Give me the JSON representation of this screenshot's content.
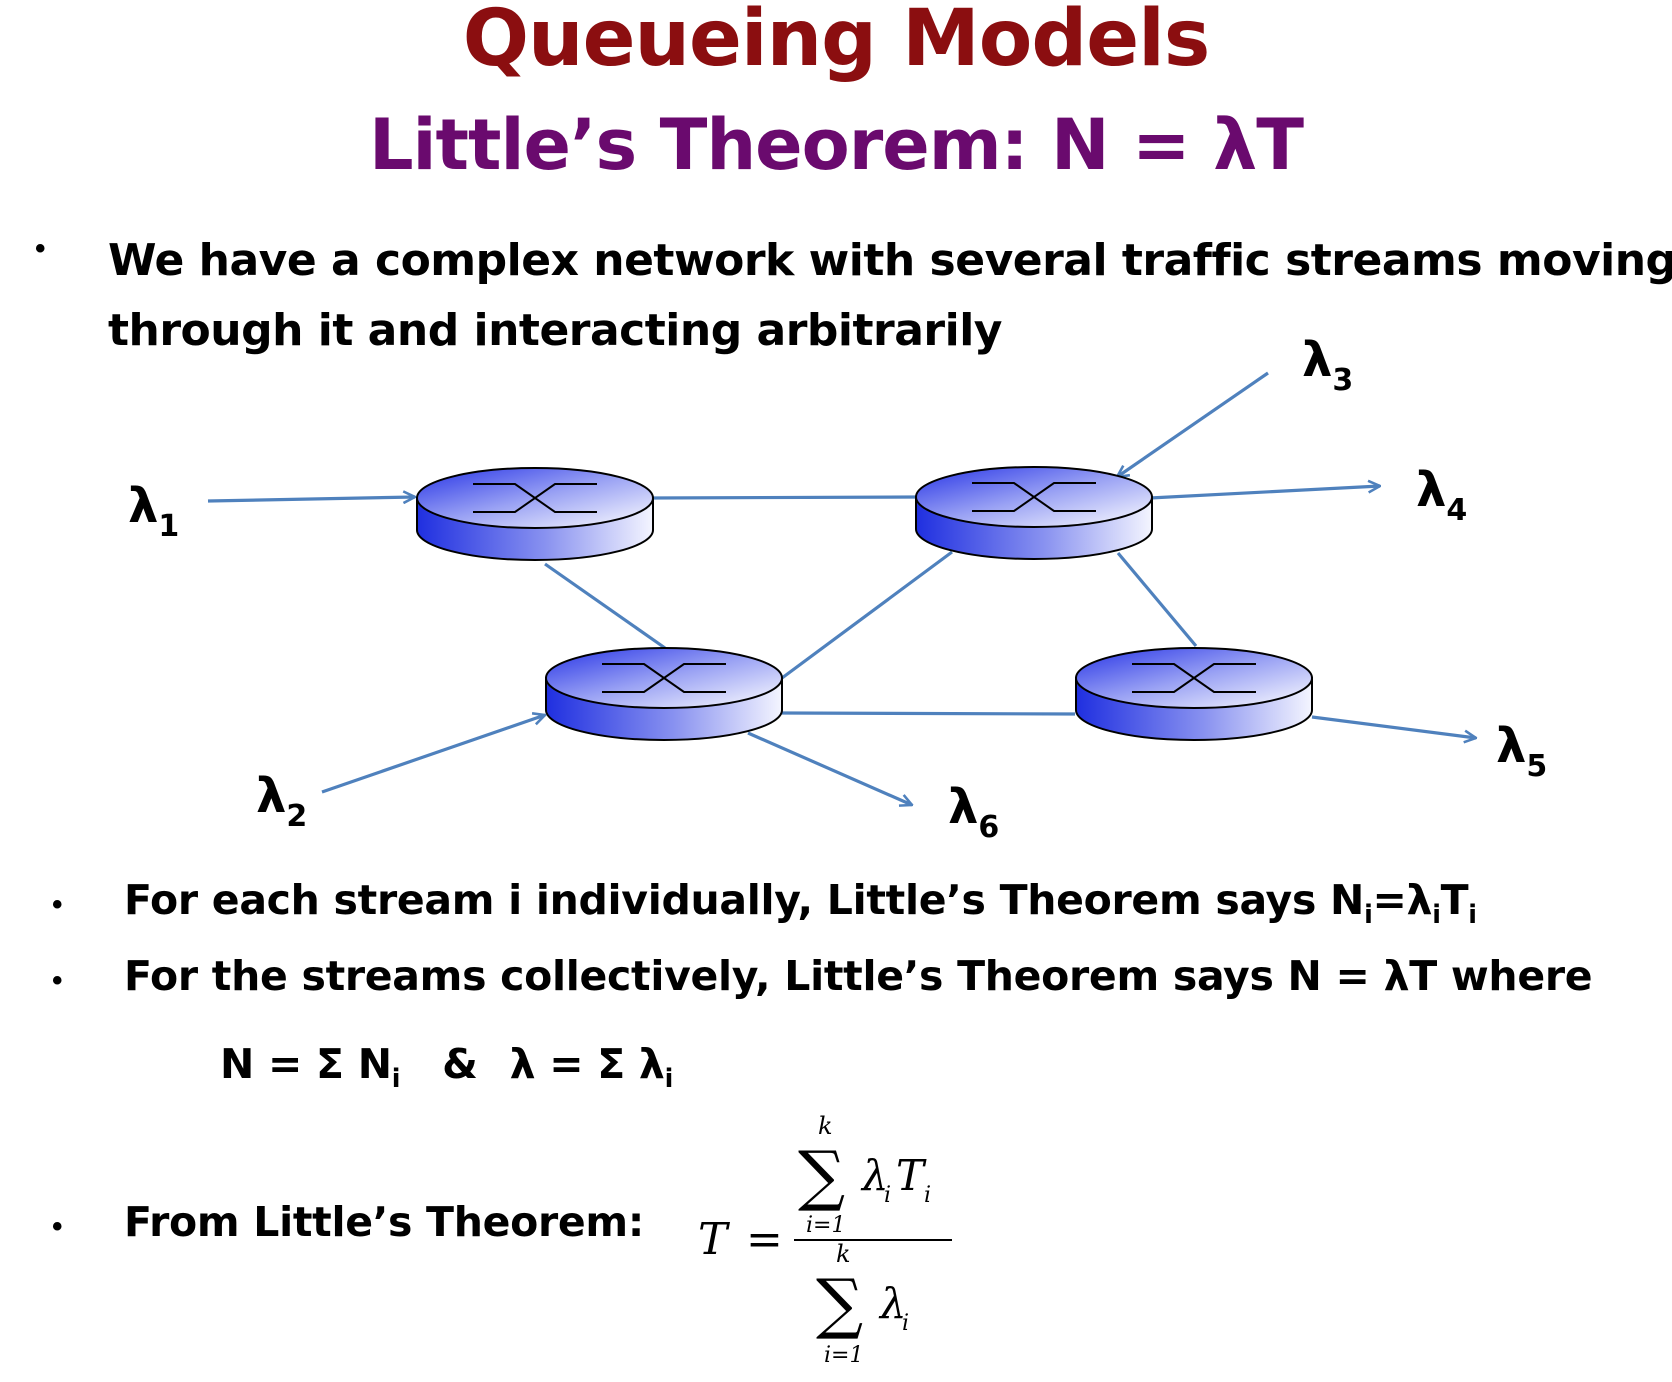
{
  "title": "Queueing Models",
  "subtitle": "Little’s Theorem: N = λT",
  "bullets": {
    "b1_line1": "We have a complex network with several traffic streams moving",
    "b1_line2": "through it and interacting arbitrarily",
    "b2_text": "For each stream i individually, Little’s Theorem says N",
    "b2_eq": "=λ",
    "b2_T": "T",
    "b3_text": "For the streams collectively, Little’s Theorem says N = λT where",
    "b4_text": "From Little’s Theorem:"
  },
  "sums": {
    "N_part": "N = Σ N",
    "amp": "&",
    "lam_part": "λ = Σ λ",
    "sub_i": "i"
  },
  "formula": {
    "lhs": "T",
    "equals": "=",
    "k": "k",
    "i1": "i=1",
    "num_lambda": "λ",
    "num_T": "T",
    "den_lambda": "λ",
    "sub_i": "i",
    "sigma": "∑"
  },
  "streams": {
    "l1": {
      "symbol": "λ",
      "sub": "1"
    },
    "l2": {
      "symbol": "λ",
      "sub": "2"
    },
    "l3": {
      "symbol": "λ",
      "sub": "3"
    },
    "l4": {
      "symbol": "λ",
      "sub": "4"
    },
    "l5": {
      "symbol": "λ",
      "sub": "5"
    },
    "l6": {
      "symbol": "λ",
      "sub": "6"
    }
  },
  "colors": {
    "title": "#8b0e10",
    "subtitle": "#6a0a6e",
    "link": "#4f81bd",
    "router_dark": "#1f2fe0",
    "router_light": "#eef0ff"
  },
  "icons": {
    "router": "router-icon",
    "bullet": "bullet-icon"
  }
}
